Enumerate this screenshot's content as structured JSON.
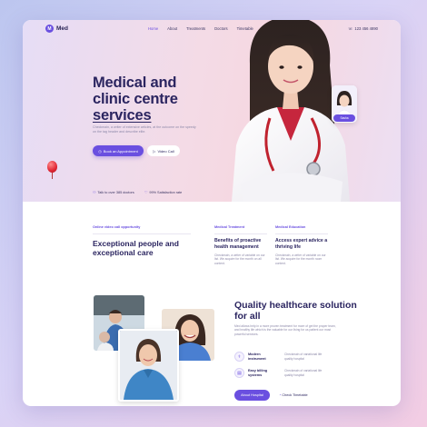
{
  "brand": {
    "name": "Med",
    "mark": "M",
    "accent": "#6a4fe0"
  },
  "nav": {
    "items": [
      "Home",
      "About",
      "Treatments",
      "Doctors",
      "Timetable"
    ],
    "phone": "123 456 4890"
  },
  "hero": {
    "title_line1": "Medical and",
    "title_line2": "clinic centre",
    "title_line3": "services",
    "description": "Checkmain, a writer of extensive articles, at the outcome on the speedy on the tag header and describe elite.",
    "cta_label": "Book an Appointment",
    "video_label": "Video Call",
    "stat_doctors": "Talk to over 385 doctors",
    "stat_satisfaction": "99% Satisfaction rate",
    "mini_card_label": "Sasha"
  },
  "services": {
    "eyebrow": "Online video call opportunity",
    "title": "Exceptional people and exceptional care",
    "col1": {
      "eyebrow": "Medical Treatment",
      "title": "Benefits of proactive health management",
      "text": "Checkmain, a writer of variable on our list. We acquire for the month on all content."
    },
    "col2": {
      "eyebrow": "Medical Education",
      "title": "Access expert advice a thriving life",
      "text": "Checkmain, a writer of variable on our list. We acquire for the month room content."
    }
  },
  "quality": {
    "title": "Quality healthcare solution for all",
    "text": "Med allows help in a more proven treatment for more of get the proper team, and healthy life which is the valuable for our living for us patient our most powerful services.",
    "features": [
      {
        "icon": "instrument-icon",
        "title": "Modern instrument",
        "text": "Checkmain of variational life quality hospital"
      },
      {
        "icon": "billing-icon",
        "title": "Easy billing systems",
        "text": "Checkmain of variational life quality hospital"
      }
    ],
    "about_label": "About Hospital",
    "check_label": "Check Timetable"
  }
}
